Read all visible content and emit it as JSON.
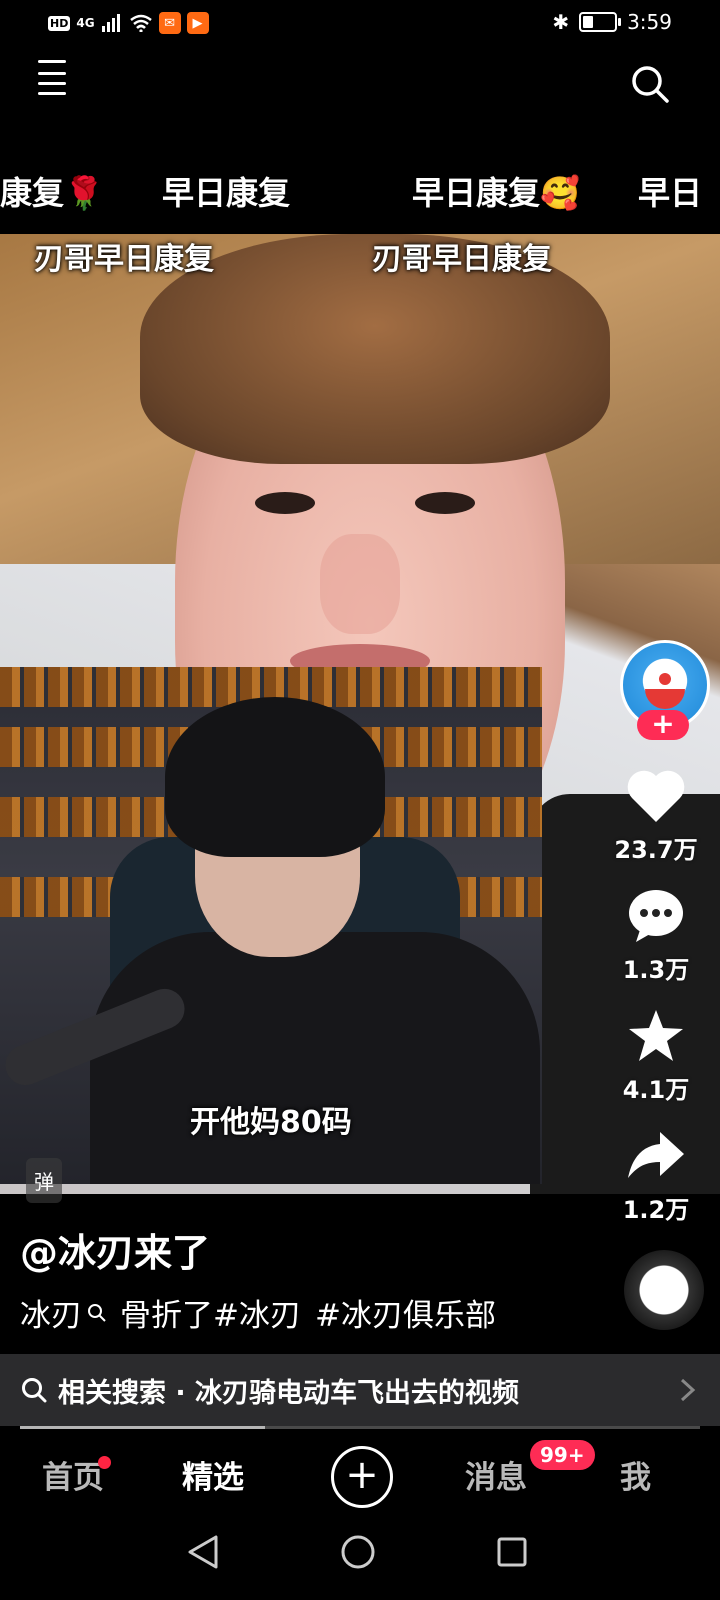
{
  "status_bar": {
    "hd": "HD",
    "network": "4G",
    "time": "3:59",
    "battery_level": 0.4,
    "app_icons": [
      "message-app-icon",
      "video-app-icon"
    ]
  },
  "top_bar": {
    "menu_has_notification": true,
    "icons": [
      "menu-icon",
      "search-icon"
    ]
  },
  "danmu": [
    {
      "text": "康复🌹"
    },
    {
      "text": "早日康复"
    },
    {
      "text": "早日康复🥰"
    },
    {
      "text": "早日"
    }
  ],
  "video": {
    "overlay_labels": [
      "刃哥早日康复",
      "刃哥早日康复"
    ],
    "inset_caption": "开他妈80码",
    "watermark": "弹"
  },
  "actions": {
    "likes": "23.7万",
    "comments": "1.3万",
    "favorites": "4.1万",
    "shares": "1.2万",
    "follow_label": "+"
  },
  "post": {
    "author": "@冰刃来了",
    "keyword": "冰刃",
    "text": "骨折了",
    "tags": [
      "#冰刃",
      "#冰刃俱乐部"
    ]
  },
  "related_search": {
    "label": "相关搜索 · 冰刃骑电动车飞出去的视频",
    "progress": 0.36
  },
  "bottom_nav": {
    "items": [
      "首页",
      "精选",
      "+",
      "消息",
      "我"
    ],
    "active": "精选",
    "message_badge": "99+"
  },
  "colors": {
    "accent": "#fe2c55",
    "background": "#000000",
    "related_bar": "#2b2b2d"
  }
}
